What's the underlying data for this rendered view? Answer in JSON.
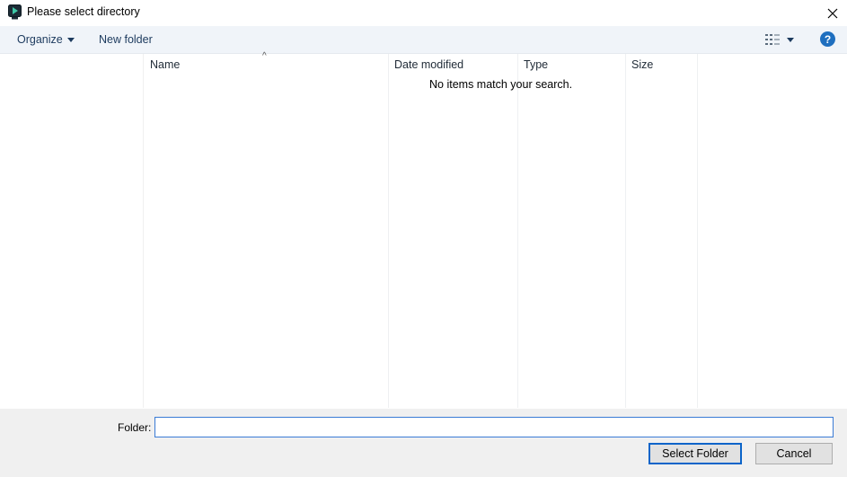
{
  "window": {
    "title": "Please select directory",
    "app_icon": "app-icon",
    "close_icon": "close-icon"
  },
  "toolbar": {
    "organize_label": "Organize",
    "new_folder_label": "New folder",
    "view_icon": "details-view-icon",
    "help_label": "?"
  },
  "file_list": {
    "columns": [
      "Name",
      "Date modified",
      "Type",
      "Size"
    ],
    "sort_indicator": "^",
    "empty_message": "No items match your search."
  },
  "footer": {
    "folder_label": "Folder:",
    "folder_value": "",
    "select_button_label": "Select Folder",
    "cancel_button_label": "Cancel"
  },
  "colors": {
    "toolbar_bg": "#f0f4f9",
    "footer_bg": "#f0f0f0",
    "accent": "#0a64c9",
    "help_blue": "#1f6fbf"
  }
}
